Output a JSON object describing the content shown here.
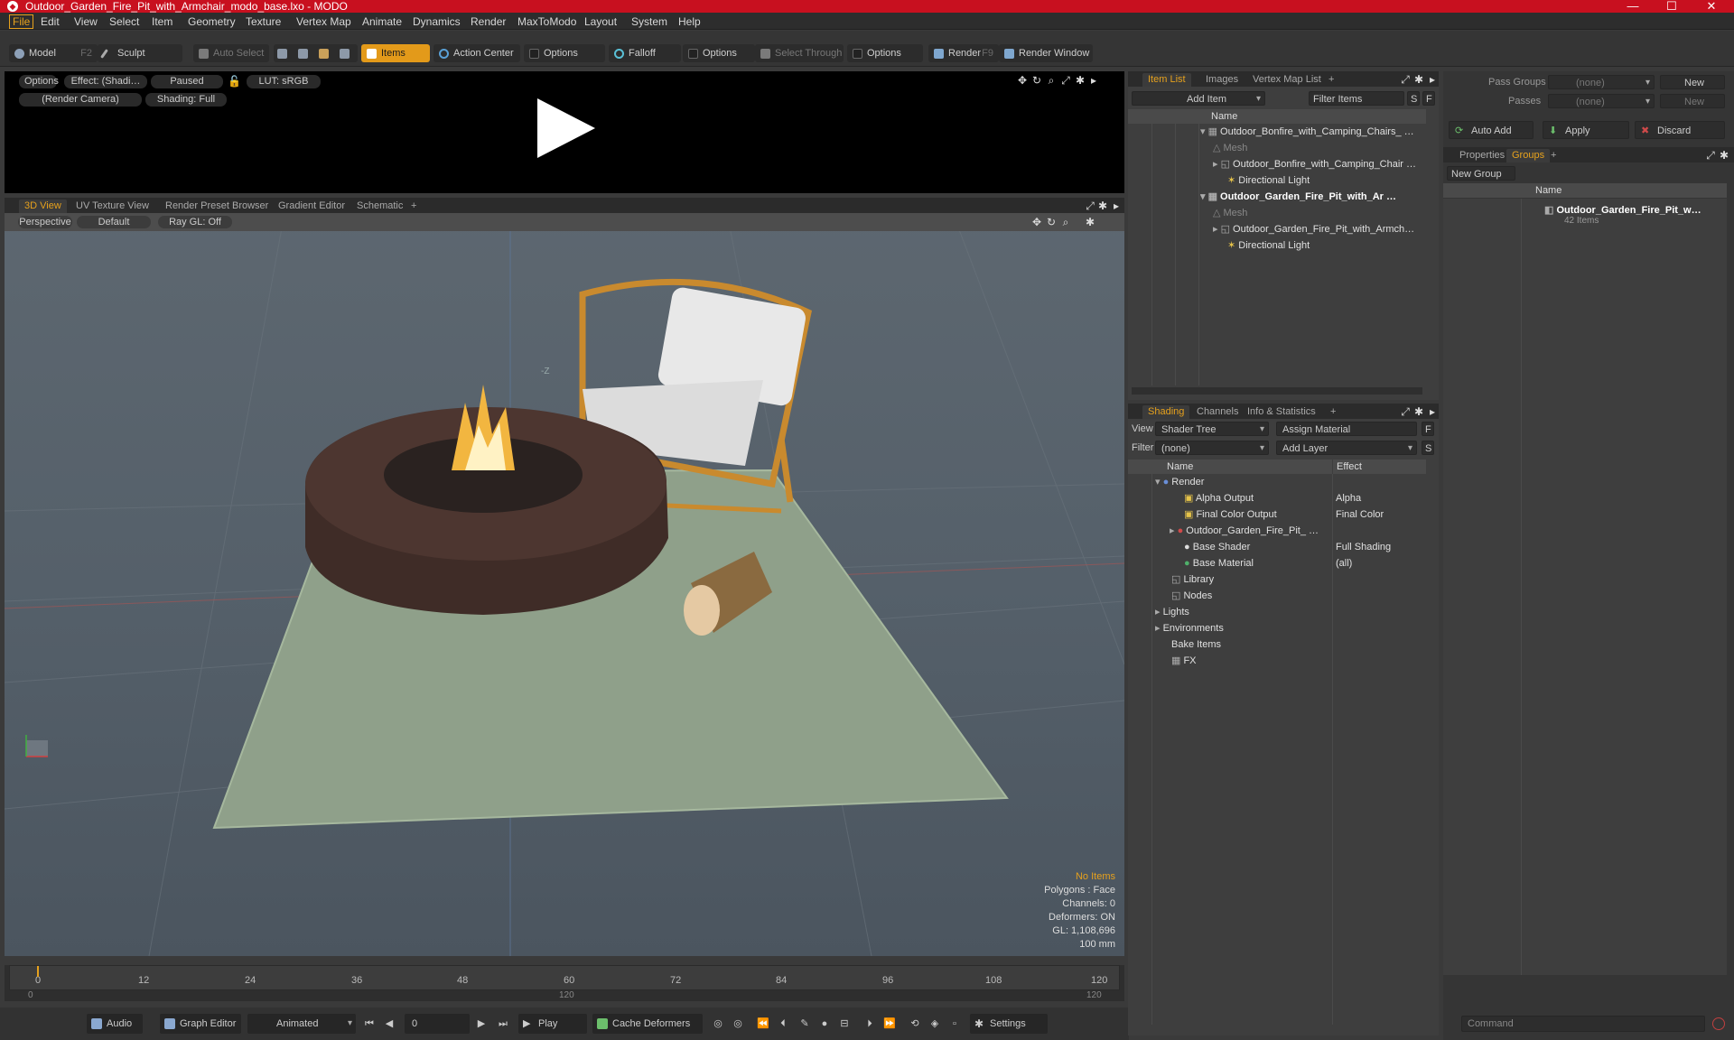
{
  "window": {
    "title": "Outdoor_Garden_Fire_Pit_with_Armchair_modo_base.lxo - MODO",
    "minimize": "—",
    "maximize": "☐",
    "close": "✕"
  },
  "menu": [
    "File",
    "Edit",
    "View",
    "Select",
    "Item",
    "Geometry",
    "Texture",
    "Vertex Map",
    "Animate",
    "Dynamics",
    "Render",
    "MaxToModo",
    "Layout",
    "System",
    "Help"
  ],
  "toolbar": {
    "model": "Model",
    "model_key": "F2",
    "sculpt": "Sculpt",
    "auto_select": "Auto Select",
    "items": "Items",
    "action_center": "Action Center",
    "options1": "Options",
    "falloff": "Falloff",
    "options2": "Options",
    "select_through": "Select Through",
    "options3": "Options",
    "render": "Render",
    "render_key": "F9",
    "render_window": "Render Window"
  },
  "preview": {
    "options": "Options",
    "effect": "Effect: (Shadi…",
    "paused": "Paused",
    "lut": "LUT: sRGB",
    "camera": "(Render Camera)",
    "shading": "Shading: Full"
  },
  "view_tabs": [
    "3D View",
    "UV Texture View",
    "Render Preset Browser",
    "Gradient Editor",
    "Schematic",
    "+"
  ],
  "viewport": {
    "perspective": "Perspective",
    "default": "Default",
    "raygl": "Ray GL: Off",
    "axis_z": "-Z",
    "hud": {
      "no_items": "No Items",
      "polygons": "Polygons : Face",
      "channels": "Channels: 0",
      "deformers": "Deformers: ON",
      "gl": "GL: 1,108,696",
      "scale": "100 mm"
    }
  },
  "timeline": {
    "ticks": [
      "0",
      "12",
      "24",
      "36",
      "48",
      "60",
      "72",
      "84",
      "96",
      "108",
      "120"
    ],
    "start": "0",
    "end": "120",
    "mid": "120"
  },
  "bottom": {
    "audio": "Audio",
    "graph_editor": "Graph Editor",
    "animated": "Animated",
    "frame": "0",
    "play": "Play",
    "cache_deformers": "Cache Deformers",
    "settings": "Settings"
  },
  "item_list": {
    "tabs": [
      "Item List",
      "Images",
      "Vertex Map List",
      "+"
    ],
    "add_item": "Add Item",
    "filter_items": "Filter Items",
    "s": "S",
    "f": "F",
    "col_name": "Name",
    "rows": [
      {
        "label": "Outdoor_Bonfire_with_Camping_Chairs_ …",
        "bold": false,
        "dim": false
      },
      {
        "label": "Mesh",
        "bold": false,
        "dim": true
      },
      {
        "label": "Outdoor_Bonfire_with_Camping_Chair …",
        "bold": false,
        "dim": false
      },
      {
        "label": "Directional Light",
        "bold": false,
        "dim": false
      },
      {
        "label": "Outdoor_Garden_Fire_Pit_with_Ar …",
        "bold": true,
        "dim": false
      },
      {
        "label": "Mesh",
        "bold": false,
        "dim": true
      },
      {
        "label": "Outdoor_Garden_Fire_Pit_with_Armch…",
        "bold": false,
        "dim": false
      },
      {
        "label": "Directional Light",
        "bold": false,
        "dim": false
      }
    ]
  },
  "shading": {
    "tabs": [
      "Shading",
      "Channels",
      "Info & Statistics",
      "+"
    ],
    "view_label": "View",
    "view_value": "Shader Tree",
    "assign_material": "Assign Material",
    "filter_label": "Filter",
    "filter_value": "(none)",
    "add_layer": "Add Layer",
    "col_name": "Name",
    "col_effect": "Effect",
    "rows": [
      {
        "label": "Render",
        "effect": ""
      },
      {
        "label": "Alpha Output",
        "effect": "Alpha"
      },
      {
        "label": "Final Color Output",
        "effect": "Final Color"
      },
      {
        "label": "Outdoor_Garden_Fire_Pit_ …",
        "effect": ""
      },
      {
        "label": "Base Shader",
        "effect": "Full Shading"
      },
      {
        "label": "Base Material",
        "effect": "(all)"
      },
      {
        "label": "Library",
        "effect": ""
      },
      {
        "label": "Nodes",
        "effect": ""
      },
      {
        "label": "Lights",
        "effect": ""
      },
      {
        "label": "Environments",
        "effect": ""
      },
      {
        "label": "Bake Items",
        "effect": ""
      },
      {
        "label": "FX",
        "effect": ""
      }
    ]
  },
  "groups": {
    "pass_groups": "Pass Groups",
    "passes": "Passes",
    "none": "(none)",
    "new": "New",
    "auto_add": "Auto Add",
    "apply": "Apply",
    "discard": "Discard",
    "tabs": [
      "Properties",
      "Groups",
      "+"
    ],
    "new_group": "New Group",
    "col_name": "Name",
    "group_name": "Outdoor_Garden_Fire_Pit_w…",
    "group_count": "42 Items",
    "command": "Command"
  }
}
